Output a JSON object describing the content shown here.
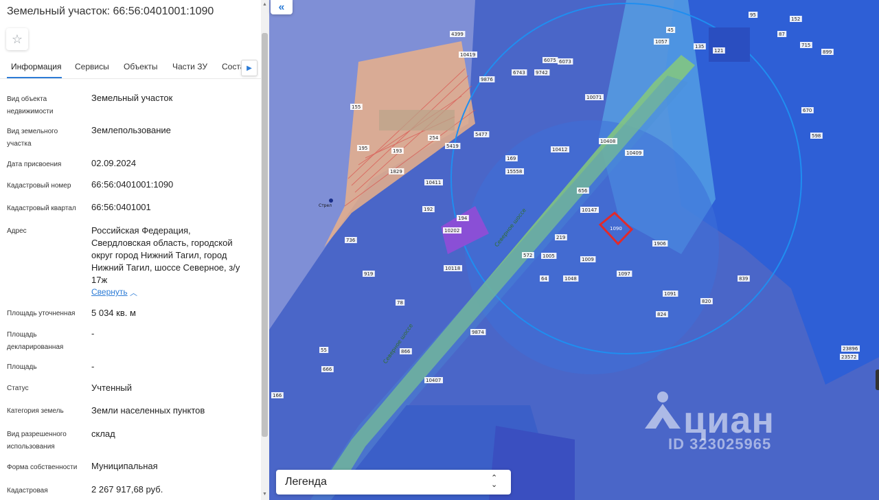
{
  "panel": {
    "title": "Земельный участок: 66:56:0401001:1090",
    "favorite_icon": "star-icon"
  },
  "tabs": [
    {
      "label": "Информация",
      "active": true
    },
    {
      "label": "Сервисы",
      "active": false
    },
    {
      "label": "Объекты",
      "active": false
    },
    {
      "label": "Части ЗУ",
      "active": false
    },
    {
      "label": "Состав",
      "active": false
    }
  ],
  "tabs_next_icon": "chevron-right-icon",
  "details": [
    {
      "label": "Вид объекта недвижимости",
      "value": "Земельный участок"
    },
    {
      "label": "Вид земельного участка",
      "value": "Землепользование"
    },
    {
      "label": "Дата присвоения",
      "value": "02.09.2024"
    },
    {
      "label": "Кадастровый номер",
      "value": "66:56:0401001:1090"
    },
    {
      "label": "Кадастровый квартал",
      "value": "66:56:0401001"
    },
    {
      "label": "Адрес",
      "value": "Российская Федерация, Свердловская область, городской округ город Нижний Тагил, город Нижний Тагил, шоссе Северное, з/у 17ж"
    },
    {
      "label": "Площадь уточненная",
      "value": "5 034 кв. м"
    },
    {
      "label": "Площадь декларированная",
      "value": "-"
    },
    {
      "label": "Площадь",
      "value": "-"
    },
    {
      "label": "Статус",
      "value": "Учтенный"
    },
    {
      "label": "Категория земель",
      "value": "Земли населенных пунктов"
    },
    {
      "label": "Вид разрешенного использования",
      "value": "склад"
    },
    {
      "label": "Форма собственности",
      "value": "Муниципальная"
    },
    {
      "label": "Кадастровая",
      "value": "2 267 917,68 руб."
    }
  ],
  "collapse_link": "Свернуть",
  "map": {
    "collapse_button_icon": "double-chevron-left-icon",
    "legend_label": "Легенда",
    "legend_toggle_icon": "chevron-up-down-icon",
    "watermark_brand": "циан",
    "watermark_id": "ID 323025965",
    "selected_parcel_label": "1090",
    "road_label": "Северное шоссе",
    "stop_label": "Стрел",
    "parcel_labels": [
      "4399",
      "10419",
      "6075",
      "6073",
      "9876",
      "6743",
      "9742",
      "10071",
      "1057",
      "135",
      "121",
      "95",
      "152",
      "45",
      "87",
      "715",
      "899",
      "155",
      "195",
      "254",
      "5419",
      "5477",
      "193",
      "1829",
      "10411",
      "10412",
      "10408",
      "10409",
      "169",
      "15558",
      "192",
      "194",
      "10202",
      "10118",
      "656",
      "10147",
      "219",
      "1005",
      "1009",
      "1048",
      "1097",
      "1906",
      "1091",
      "824",
      "839",
      "820",
      "23896",
      "23572",
      "64",
      "572",
      "919",
      "78",
      "9874",
      "736",
      "55",
      "666",
      "866",
      "10407",
      "166",
      "670",
      "598"
    ],
    "colors": {
      "zone_dark": "#2f62d6",
      "zone_mid": "#4e78d6",
      "zone_light": "#3a8be8",
      "rail_zone": "#f1b48c",
      "road": "#8fd37a",
      "selected": "#e22a2a",
      "building": "#8a4fd6"
    }
  }
}
